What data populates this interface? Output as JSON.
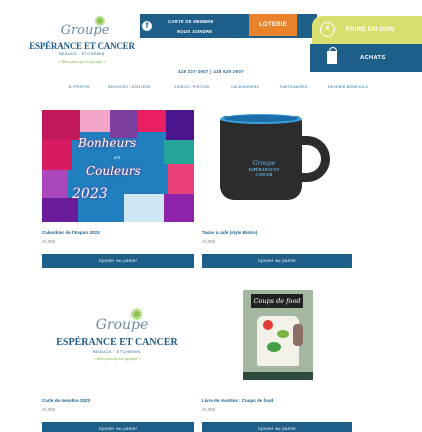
{
  "header": {
    "logo": {
      "groupe": "Groupe",
      "name": "ESPÉRANCE ET CANCER",
      "subtitle": "BEAUCE · ETCHEMIN",
      "tagline": "« Bien plus qu'un groupe »"
    },
    "top_links": {
      "membership": "CARTE DE MEMBRE",
      "volunteer": "NOUS JOINDRE"
    },
    "loterie_label": "LOTERIE",
    "donate_label": "FAIRE UN DON",
    "achats_label": "ACHATS",
    "phones": "418 227-3607  |  418 625-2607"
  },
  "nav": {
    "items": [
      "À PROPOS",
      "SERVICES / ATELIERS",
      "VIDÉOS / PHOTOS",
      "CALENDRIERS",
      "PARTENAIRES",
      "DEVENIR BÉNÉVOLE"
    ]
  },
  "products": [
    {
      "name": "Calendrier de l'Espoir 2023",
      "price": "20,00$",
      "button": "Ajouter au panier",
      "image_text": [
        "Bonheurs",
        "en",
        "Couleurs",
        "2023"
      ]
    },
    {
      "name": "Tasse à café (style Bistro)",
      "price": "15,00$",
      "button": "Ajouter au panier",
      "image_text": [
        "Groupe",
        "ESPÉRANCE ET CANCER"
      ]
    },
    {
      "name": "Carte de membre 2023",
      "price": "20,00$",
      "button": "Ajouter au panier",
      "image_text": [
        "Groupe",
        "ESPÉRANCE ET CANCER",
        "BEAUCE · ETCHEMIN",
        "« Bien plus qu'un groupe »"
      ]
    },
    {
      "name": "Livre de recettes : Coups de food",
      "price": "20,00$",
      "button": "Ajouter au panier",
      "image_text": [
        "Coups de food"
      ]
    }
  ],
  "colors": {
    "primary": "#1e5f8a",
    "loterie": "#e8832b",
    "donate": "#d8df6e"
  }
}
